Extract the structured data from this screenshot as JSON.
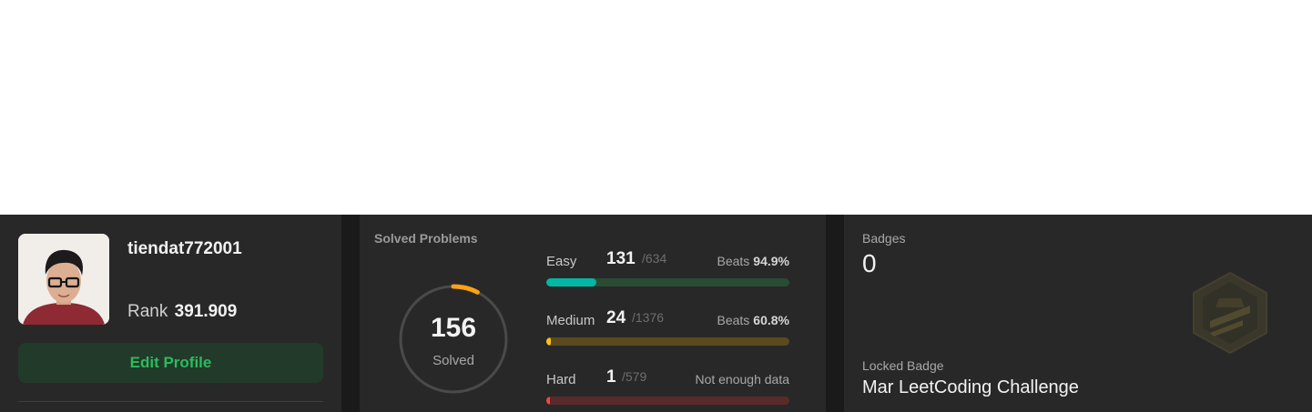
{
  "profile": {
    "username": "tiendat772001",
    "rank_label": "Rank",
    "rank_value": "391.909",
    "edit_button": "Edit Profile"
  },
  "solved": {
    "title": "Solved Problems",
    "total_solved": "156",
    "solved_label": "Solved",
    "accent_color": "#ffa116",
    "difficulties": [
      {
        "name": "Easy",
        "solved": "131",
        "total": "/634",
        "beats_label": "Beats",
        "beats_value": "94.9%",
        "fraction": 0.2066,
        "color": "#00b8a3",
        "track_color": "#2a4b34"
      },
      {
        "name": "Medium",
        "solved": "24",
        "total": "/1376",
        "beats_label": "Beats",
        "beats_value": "60.8%",
        "fraction": 0.0174,
        "color": "#ffc01e",
        "track_color": "#5a4a1e"
      },
      {
        "name": "Hard",
        "solved": "1",
        "total": "/579",
        "beats_label": "",
        "beats_value": "",
        "note": "Not enough data",
        "fraction": 0.0017,
        "color": "#ef4743",
        "track_color": "#5a2a2a"
      }
    ]
  },
  "badges": {
    "label": "Badges",
    "count": "0",
    "locked_label": "Locked Badge",
    "locked_name": "Mar LeetCoding Challenge"
  }
}
